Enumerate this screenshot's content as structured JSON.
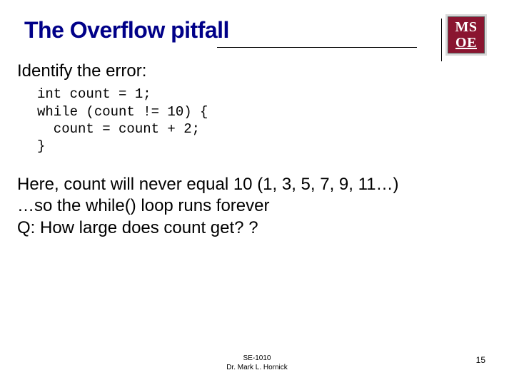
{
  "header": {
    "title": "The Overflow pitfall",
    "logo_line1": "MS",
    "logo_line2": "OE"
  },
  "content": {
    "prompt": "Identify the error:",
    "code": "int count = 1;\nwhile (count != 10) {\n  count = count + 2;\n}",
    "body_line1": "Here, count will never equal 10 (1, 3, 5, 7, 9, 11…)",
    "body_line2": "…so the while() loop runs forever",
    "body_line3": "Q: How large does count get? ?"
  },
  "footer": {
    "course": "SE-1010",
    "author": "Dr. Mark L. Hornick",
    "page": "15"
  }
}
